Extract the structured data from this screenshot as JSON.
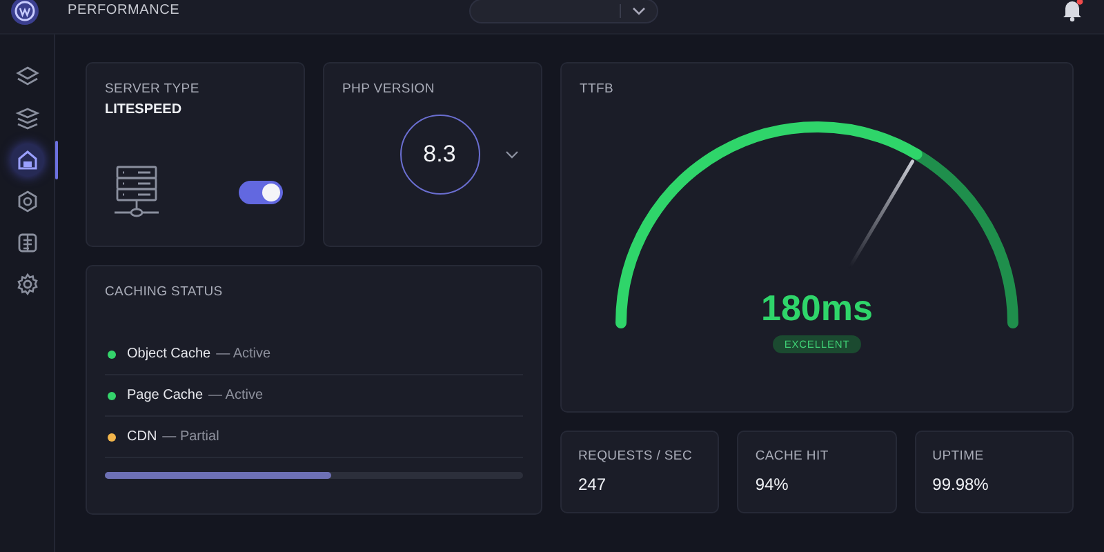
{
  "header": {
    "title": "PERFORMANCE",
    "notification_badge": true
  },
  "sidebar": {
    "items": [
      {
        "selected": false
      },
      {
        "selected": false
      },
      {
        "selected": true
      },
      {
        "selected": false
      },
      {
        "selected": false
      },
      {
        "selected": false
      }
    ]
  },
  "server": {
    "label": "SERVER TYPE",
    "value": "LITESPEED",
    "toggle_on": true
  },
  "php": {
    "label": "PHP VERSION",
    "version": "8.3"
  },
  "caching": {
    "title": "CACHING STATUS",
    "items": [
      {
        "name": "Object Cache",
        "status": "— Active",
        "color": "#34d36b"
      },
      {
        "name": "Page Cache",
        "status": "— Active",
        "color": "#34d36b"
      },
      {
        "name": "CDN",
        "status": "— Partial",
        "color": "#f2b54b"
      }
    ],
    "progress": {
      "level": 0.54
    }
  },
  "ttfb": {
    "title": "TTFB",
    "value": "180ms",
    "rating": "EXCELLENT"
  },
  "stats": [
    {
      "label": "REQUESTS / SEC",
      "value": "247"
    },
    {
      "label": "CACHE HIT",
      "value": "94%"
    },
    {
      "label": "UPTIME",
      "value": "99.98%"
    }
  ]
}
